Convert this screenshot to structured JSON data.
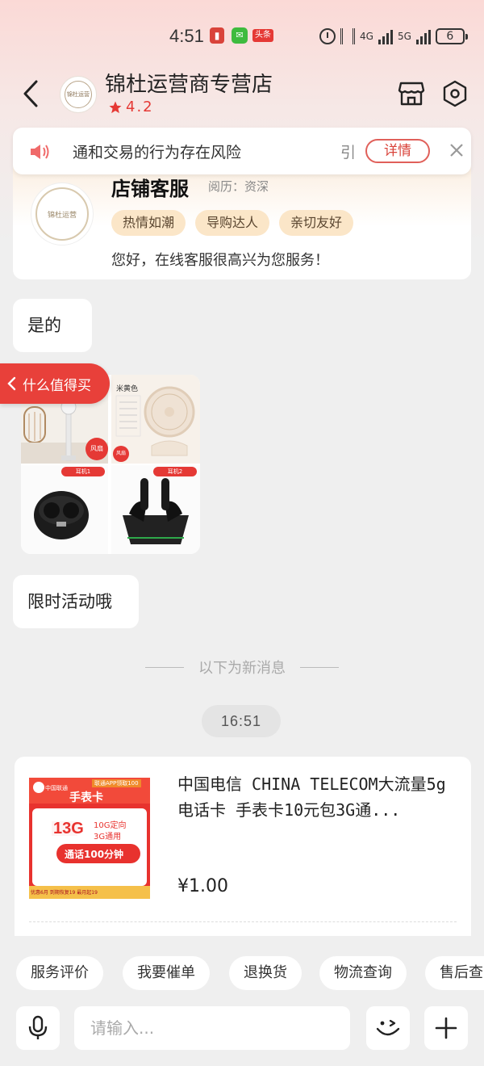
{
  "status_bar": {
    "time": "4:51",
    "app_badge_1": "▮",
    "app_badge_2": "✉",
    "app_badge_3": "头条",
    "net_4g": "4G",
    "net_5g": "5G",
    "battery": "6"
  },
  "header": {
    "store_name": "锦杜运营商专营店",
    "rating": "4.2",
    "logo_text": "锦杜运营"
  },
  "notice": {
    "text": "通和交易的行为存在风险",
    "tail": "引",
    "detail_label": "详情"
  },
  "service_card": {
    "title": "店铺客服",
    "experience": "阅历：资深",
    "tags": [
      "热情如潮",
      "导购达人",
      "亲切友好"
    ],
    "greeting": "您好，在线客服很高兴为您服务！",
    "avatar_text": "锦杜运营"
  },
  "messages": {
    "msg1": "是的",
    "msg3": "限时活动哦",
    "image_card": {
      "fan_label": "米黄色",
      "badge_fan": "风扇",
      "badge_earbud1": "耳机1",
      "badge_earbud2": "耳机2"
    }
  },
  "promo_tab": {
    "label": "什么值得买"
  },
  "divider": {
    "label": "以下为新消息"
  },
  "timestamp": "16:51",
  "product": {
    "title": "中国电信 CHINA TELECOM大流量5g电话卡 手表卡10元包3G通...",
    "price": "¥1.00",
    "img": {
      "brand": "中国联通",
      "badge": "联通APP领取100",
      "card_name": "手表卡",
      "data_amount": "13G",
      "data_detail_1": "10G定向",
      "data_detail_2": "3G通用",
      "calls": "通话100分钟",
      "after_discount": "优惠后10",
      "fine_print": "优惠6月 到期恢复19 最月起19"
    }
  },
  "quick_actions": [
    "服务评价",
    "我要催单",
    "退换货",
    "物流查询",
    "售后查"
  ],
  "input": {
    "placeholder": "请输入..."
  },
  "colors": {
    "accent_red": "#e53935",
    "tag_bg": "#fbe6c8",
    "chat_bg": "#efefef"
  },
  "icons": [
    "back-arrow-icon",
    "store-icon",
    "settings-hex-icon",
    "speaker-icon",
    "close-icon",
    "voice-icon",
    "emoji-icon",
    "plus-icon",
    "star-icon"
  ]
}
